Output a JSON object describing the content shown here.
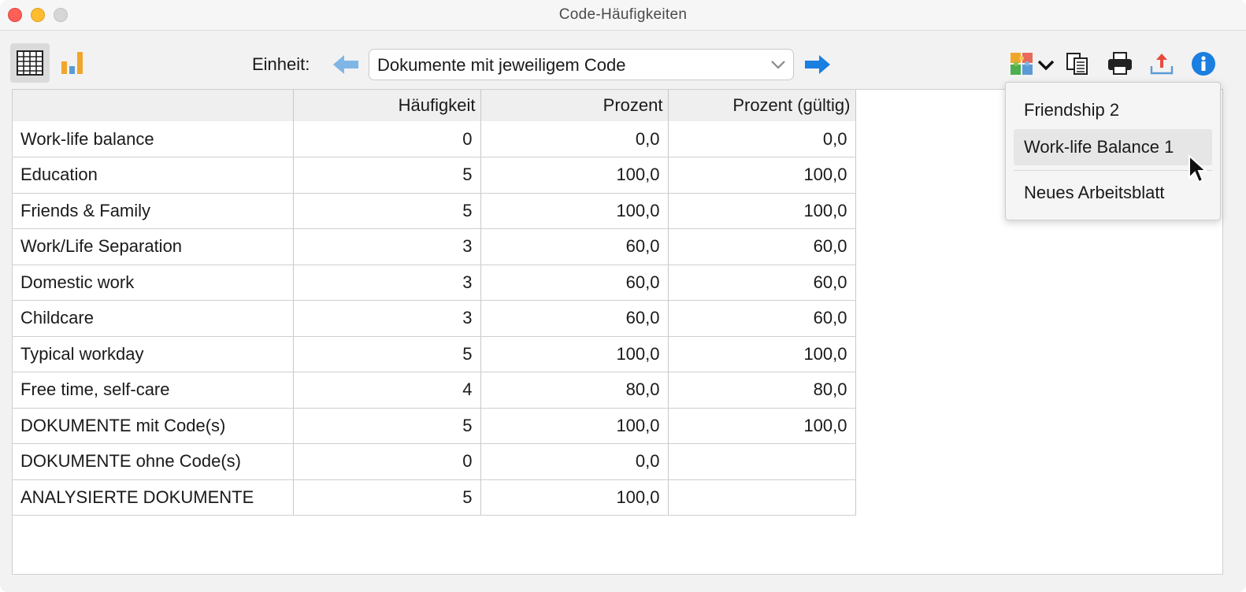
{
  "window": {
    "title": "Code-Häufigkeiten"
  },
  "toolbar": {
    "einheit_label": "Einheit:",
    "unit_select_value": "Dokumente mit jeweiligem Code",
    "icons": [
      "table-view-icon",
      "bar-chart-icon",
      "arrow-left-icon",
      "chevron-down-icon",
      "arrow-right-icon",
      "excel-icon",
      "copy-icon",
      "print-icon",
      "export-icon",
      "info-icon"
    ],
    "colors": {
      "arrow_prev": "#7fb6e6",
      "arrow_next": "#1a7fe0",
      "info": "#1a7fe0"
    }
  },
  "table": {
    "headers": [
      "",
      "Häufigkeit",
      "Prozent",
      "Prozent (gültig)"
    ],
    "rows": [
      [
        "Work-life balance",
        "0",
        "0,0",
        "0,0"
      ],
      [
        "Education",
        "5",
        "100,0",
        "100,0"
      ],
      [
        "Friends & Family",
        "5",
        "100,0",
        "100,0"
      ],
      [
        "Work/Life Separation",
        "3",
        "60,0",
        "60,0"
      ],
      [
        "Domestic work",
        "3",
        "60,0",
        "60,0"
      ],
      [
        "Childcare",
        "3",
        "60,0",
        "60,0"
      ],
      [
        "Typical workday",
        "5",
        "100,0",
        "100,0"
      ],
      [
        "Free time, self-care",
        "4",
        "80,0",
        "80,0"
      ],
      [
        "DOKUMENTE mit Code(s)",
        "5",
        "100,0",
        "100,0"
      ],
      [
        "DOKUMENTE ohne Code(s)",
        "0",
        "0,0",
        ""
      ],
      [
        "ANALYSIERTE DOKUMENTE",
        "5",
        "100,0",
        ""
      ]
    ]
  },
  "menu": {
    "items": [
      "Friendship 2",
      "Work-life Balance 1",
      "Neues Arbeitsblatt"
    ],
    "highlighted": "Work-life Balance 1"
  }
}
